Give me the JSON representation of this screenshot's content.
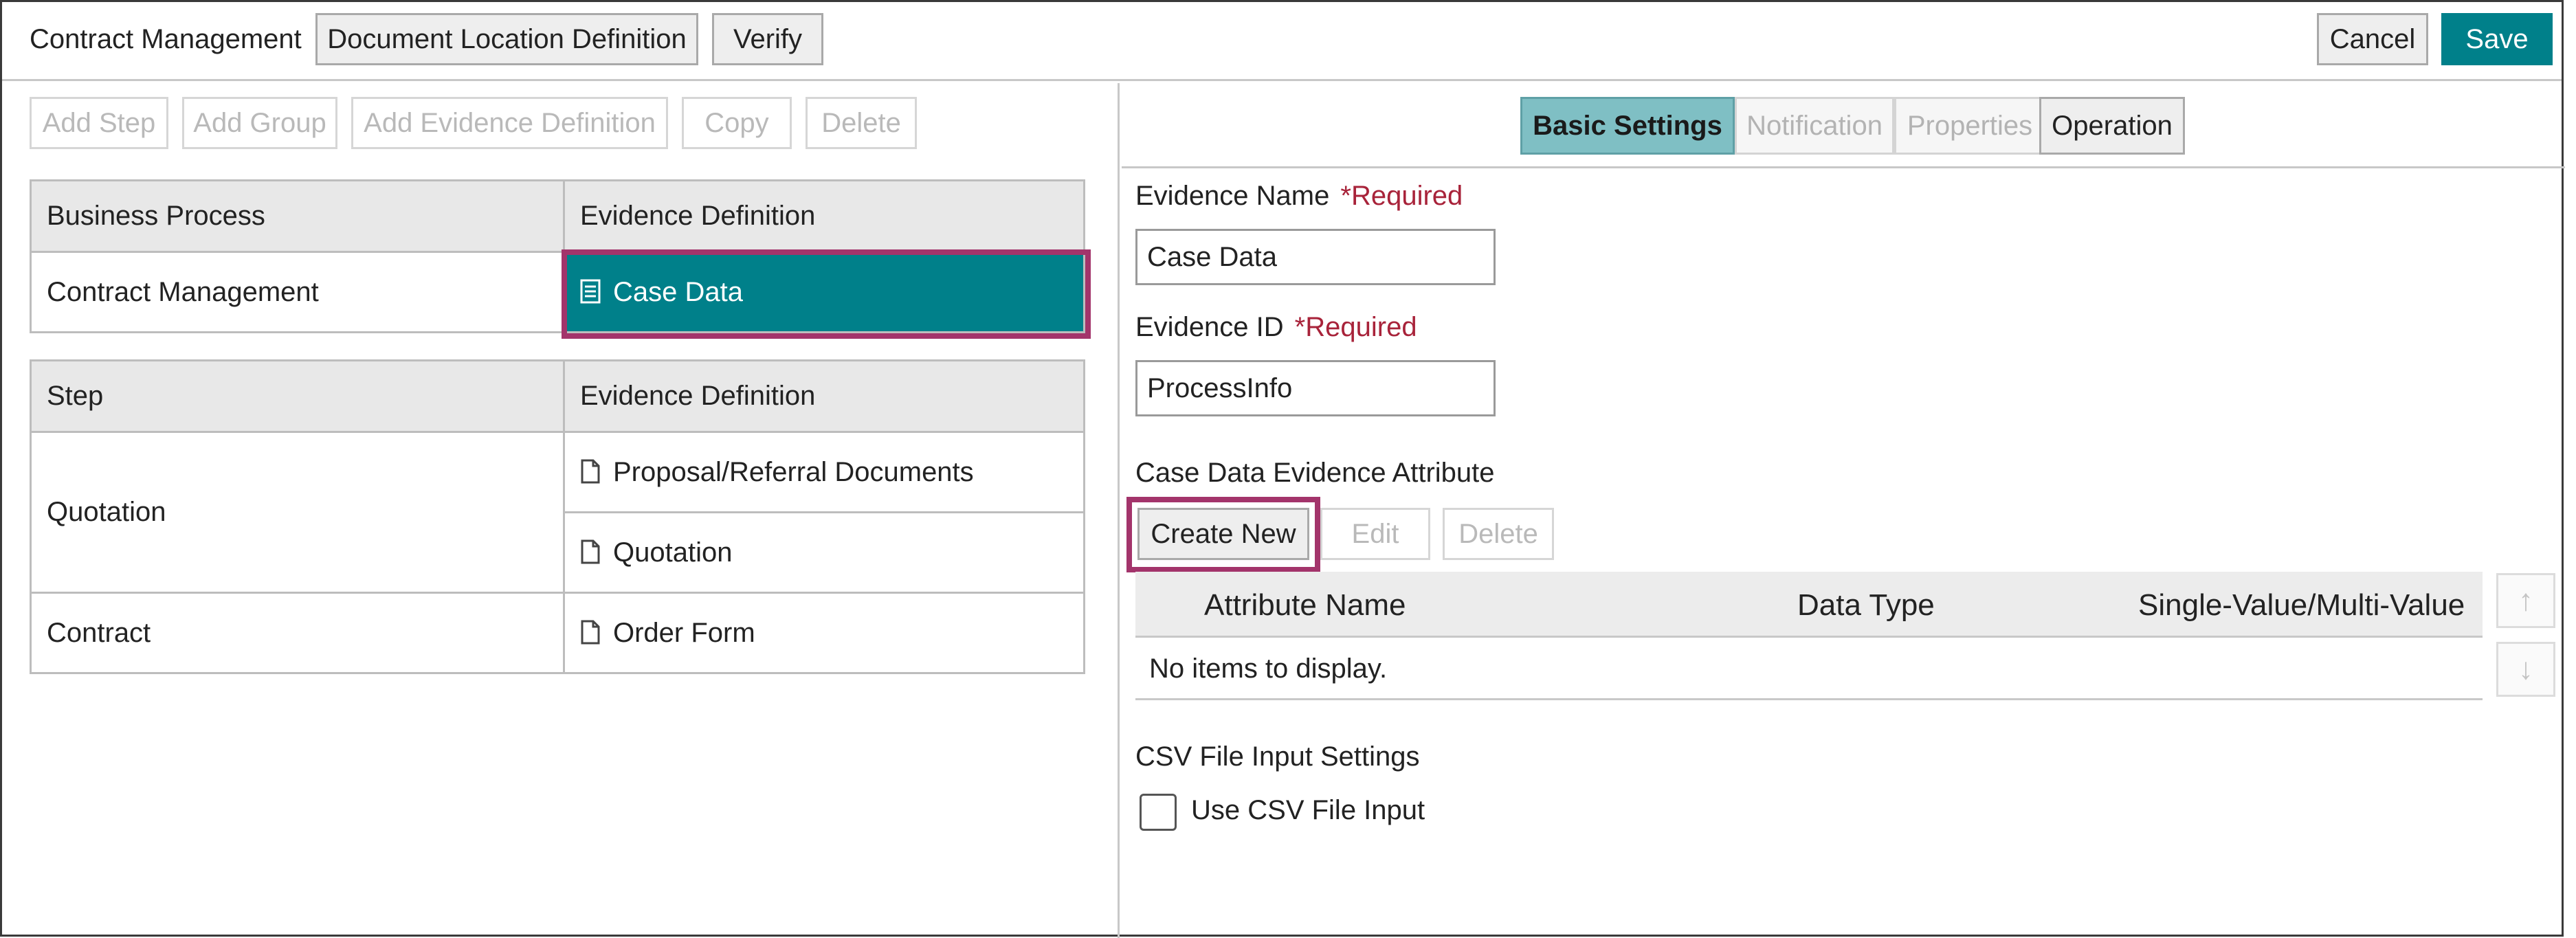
{
  "header": {
    "app_title": "Contract Management",
    "doc_location_label": "Document Location Definition",
    "verify_label": "Verify",
    "cancel_label": "Cancel",
    "save_label": "Save"
  },
  "toolbar": {
    "add_step": "Add Step",
    "add_group": "Add Group",
    "add_evidence": "Add Evidence Definition",
    "copy": "Copy",
    "delete": "Delete"
  },
  "process_table": {
    "headers": [
      "Business Process",
      "Evidence Definition"
    ],
    "rows": [
      {
        "process": "Contract Management",
        "evidence": "Case Data"
      }
    ]
  },
  "step_table": {
    "headers": [
      "Step",
      "Evidence Definition"
    ],
    "rows": [
      {
        "step": "Quotation",
        "evidence": [
          "Proposal/Referral Documents",
          "Quotation"
        ]
      },
      {
        "step": "Contract",
        "evidence": [
          "Order Form"
        ]
      }
    ]
  },
  "tabs": [
    {
      "label": "Basic Settings",
      "state": "active"
    },
    {
      "label": "Notification",
      "state": "disabled"
    },
    {
      "label": "Properties",
      "state": "disabled"
    },
    {
      "label": "Operation",
      "state": "normal"
    }
  ],
  "form": {
    "evidence_name_label": "Evidence Name",
    "required_text": "*Required",
    "evidence_name_value": "Case Data",
    "evidence_id_label": "Evidence ID",
    "evidence_id_value": "ProcessInfo",
    "attribute_section_label": "Case Data Evidence Attribute",
    "create_new": "Create New",
    "edit": "Edit",
    "delete": "Delete",
    "grid_headers": [
      "Attribute Name",
      "Data Type",
      "Single-Value/Multi-Value"
    ],
    "empty_text": "No items to display.",
    "csv_section_label": "CSV File Input Settings",
    "csv_checkbox_label": "Use CSV File Input",
    "csv_checked": false
  },
  "icons": {
    "up": "arrow-up-icon",
    "down": "arrow-down-icon",
    "case_data": "list-document-icon",
    "document": "document-icon"
  },
  "colors": {
    "accent": "#00808a",
    "highlight": "#a3346b",
    "required": "#a8233a"
  }
}
